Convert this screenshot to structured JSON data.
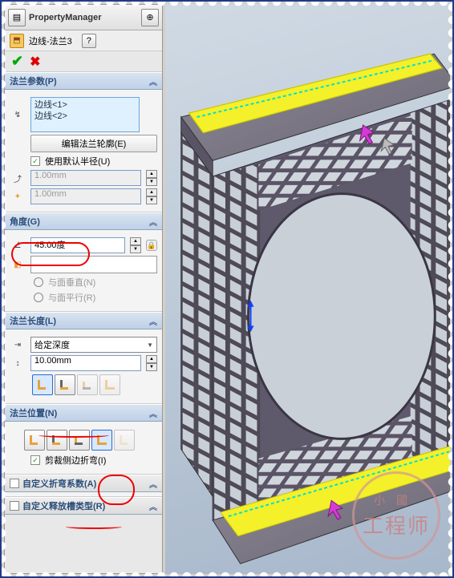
{
  "title": "PropertyManager",
  "feature_name": "边线-法兰3",
  "help_tooltip": "?",
  "sections": {
    "params": {
      "header": "法兰参数(P)",
      "edges": [
        "边线<1>",
        "边线<2>"
      ],
      "edit_profile_btn": "编辑法兰轮廓(E)",
      "use_default_radius": {
        "label": "使用默认半径(U)",
        "checked": true
      },
      "radius1": "1.00mm",
      "radius2": "1.00mm"
    },
    "angle": {
      "header": "角度(G)",
      "value": "45.00度",
      "face_ref": "",
      "perp": "与面垂直(N)",
      "parallel": "与面平行(R)"
    },
    "length": {
      "header": "法兰长度(L)",
      "end_condition": "给定深度",
      "value": "10.00mm"
    },
    "position": {
      "header": "法兰位置(N)",
      "trim_side_bends": {
        "label": "剪裁侧边折弯(I)",
        "checked": true
      }
    },
    "custom_bend": {
      "header": "自定义折弯系数(A)",
      "checked": false
    },
    "custom_relief": {
      "header": "自定义释放槽类型(R)",
      "checked": false
    }
  }
}
